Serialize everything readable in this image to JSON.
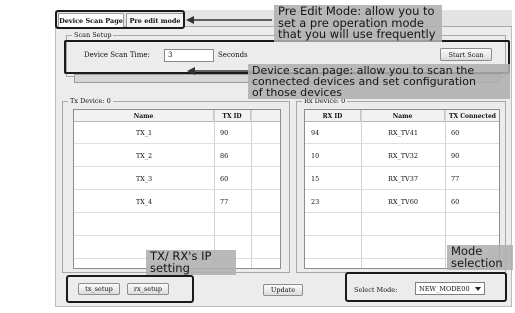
{
  "tabs": [
    {
      "label": "Device Scan Page"
    },
    {
      "label": "Pre edit mode"
    }
  ],
  "scan_setup": {
    "group_label": "Scan Setup",
    "time_label": "Device Scan Time:",
    "time_value": "3",
    "unit": "Seconds",
    "start_button": "Start Scan"
  },
  "tx": {
    "group_label": "Tx Device: 0",
    "columns": [
      "Name",
      "TX ID"
    ],
    "rows": [
      {
        "name": "TX_1",
        "id": "90"
      },
      {
        "name": "TX_2",
        "id": "86"
      },
      {
        "name": "TX_3",
        "id": "60"
      },
      {
        "name": "TX_4",
        "id": "77"
      }
    ]
  },
  "rx": {
    "group_label": "Rx Device: 0",
    "columns": [
      "RX ID",
      "Name",
      "TX Connected"
    ],
    "rows": [
      {
        "id": "94",
        "name": "RX_TV41",
        "tx": "60"
      },
      {
        "id": "10",
        "name": "RX_TV32",
        "tx": "90"
      },
      {
        "id": "15",
        "name": "RX_TV37",
        "tx": "77"
      },
      {
        "id": "23",
        "name": "RX_TV60",
        "tx": "60"
      }
    ]
  },
  "bottom": {
    "tx_setup": "tx_setup",
    "rx_setup": "rx_setup",
    "update": "Update",
    "select_mode_label": "Select Mode:",
    "select_mode_value": "NEW_MODE00"
  },
  "callouts": {
    "pre_edit": [
      "Pre Edit Mode: allow you to",
      "set a pre operation mode",
      "that you will use frequently"
    ],
    "scan_page": [
      "Device scan page:  allow you to scan the",
      "connected devices and set configuration",
      "of those devices"
    ],
    "ip_setting": [
      "TX/ RX's IP",
      "setting"
    ],
    "mode": [
      "Mode",
      "selection"
    ]
  },
  "icons": {
    "dropdown": "chevron-down-icon",
    "callout_arrow": "arrow-left-icon"
  }
}
